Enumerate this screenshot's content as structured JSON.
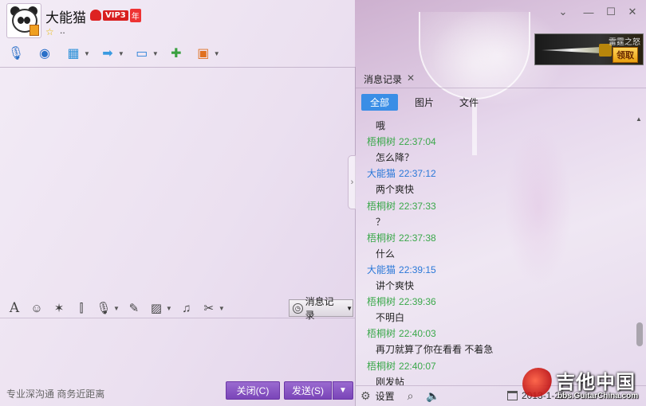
{
  "header": {
    "name": "大能猫",
    "vip_label": "VIP3",
    "vip_year": "年",
    "signature": ".."
  },
  "window_controls": [
    "chevron-down-icon",
    "minimize-icon",
    "maximize-icon",
    "close-icon"
  ],
  "toolbar": {
    "icons": [
      "microphone-icon",
      "video-camera-icon",
      "remote-desktop-icon",
      "file-transfer-icon",
      "screen-share-icon",
      "create-group-icon",
      "apps-icon"
    ]
  },
  "ad": {
    "title": "雷霆之怒",
    "claim_label": "领取"
  },
  "input_toolbar": {
    "icons": [
      "font-icon",
      "emoji-icon",
      "magic-wand-icon",
      "gif-icon",
      "voice-message-icon",
      "edit-icon",
      "image-icon",
      "music-icon",
      "scissors-icon"
    ],
    "history_label": "消息记录"
  },
  "footer": {
    "promo": "专业深沟通 商务近距离",
    "close_label": "关闭(C)",
    "send_label": "发送(S)"
  },
  "history_panel": {
    "tab_label": "消息记录",
    "filters": [
      "全部",
      "图片",
      "文件"
    ],
    "active_filter": "全部",
    "messages": [
      {
        "type": "text",
        "text": "哦"
      },
      {
        "type": "meta",
        "sender": "梧桐树",
        "time": "22:37:04",
        "color": "green"
      },
      {
        "type": "text",
        "text": "怎么降？"
      },
      {
        "type": "meta",
        "sender": "大能猫",
        "time": "22:37:12",
        "color": "blue"
      },
      {
        "type": "text",
        "text": "两个爽快"
      },
      {
        "type": "meta",
        "sender": "梧桐树",
        "time": "22:37:33",
        "color": "green"
      },
      {
        "type": "text",
        "text": "？"
      },
      {
        "type": "meta",
        "sender": "梧桐树",
        "time": "22:37:38",
        "color": "green"
      },
      {
        "type": "text",
        "text": "什么"
      },
      {
        "type": "meta",
        "sender": "大能猫",
        "time": "22:39:15",
        "color": "blue"
      },
      {
        "type": "text",
        "text": "讲个爽快"
      },
      {
        "type": "meta",
        "sender": "梧桐树",
        "time": "22:39:36",
        "color": "green"
      },
      {
        "type": "text",
        "text": "不明白"
      },
      {
        "type": "meta",
        "sender": "梧桐树",
        "time": "22:40:03",
        "color": "green"
      },
      {
        "type": "text",
        "text": "再刀就算了你在看看 不着急"
      },
      {
        "type": "meta",
        "sender": "梧桐树",
        "time": "22:40:07",
        "color": "green"
      },
      {
        "type": "text",
        "text": "刚发帖"
      }
    ],
    "footer_settings": "设置",
    "date": "2013-1-20"
  },
  "watermark": {
    "title": "吉他中国",
    "url": "bbs.GuitarChina.com"
  }
}
